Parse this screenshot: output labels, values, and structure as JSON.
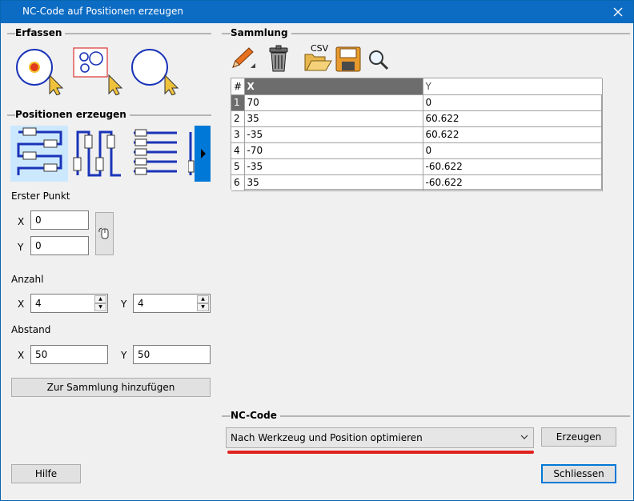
{
  "window": {
    "title": "NC-Code auf Positionen erzeugen"
  },
  "erfassen": {
    "label": "Erfassen"
  },
  "positionen": {
    "label": "Positionen erzeugen",
    "erster_punkt": {
      "label": "Erster Punkt",
      "x_label": "X",
      "x_value": "0",
      "y_label": "Y",
      "y_value": "0"
    },
    "anzahl": {
      "label": "Anzahl",
      "x_label": "X",
      "x_value": "4",
      "y_label": "Y",
      "y_value": "4"
    },
    "abstand": {
      "label": "Abstand",
      "x_label": "X",
      "x_value": "50",
      "y_label": "Y",
      "y_value": "50"
    },
    "add_button": "Zur Sammlung hinzufügen"
  },
  "sammlung": {
    "label": "Sammlung",
    "csv_label": "CSV",
    "columns": [
      "#",
      "X",
      "Y"
    ],
    "rows": [
      [
        "1",
        "70",
        "0"
      ],
      [
        "2",
        "35",
        "60.622"
      ],
      [
        "3",
        "-35",
        "60.622"
      ],
      [
        "4",
        "-70",
        "0"
      ],
      [
        "5",
        "-35",
        "-60.622"
      ],
      [
        "6",
        "35",
        "-60.622"
      ]
    ]
  },
  "nccode": {
    "label": "NC-Code",
    "combo_value": "Nach Werkzeug und Position optimieren",
    "erzeugen_button": "Erzeugen"
  },
  "footer": {
    "hilfe_button": "Hilfe",
    "schliessen_button": "Schliessen"
  },
  "colors": {
    "titlebar": "#0c6cc4",
    "accent": "#0078d7",
    "selection_tile": "#cce8ff",
    "annotation": "#e0231f"
  }
}
